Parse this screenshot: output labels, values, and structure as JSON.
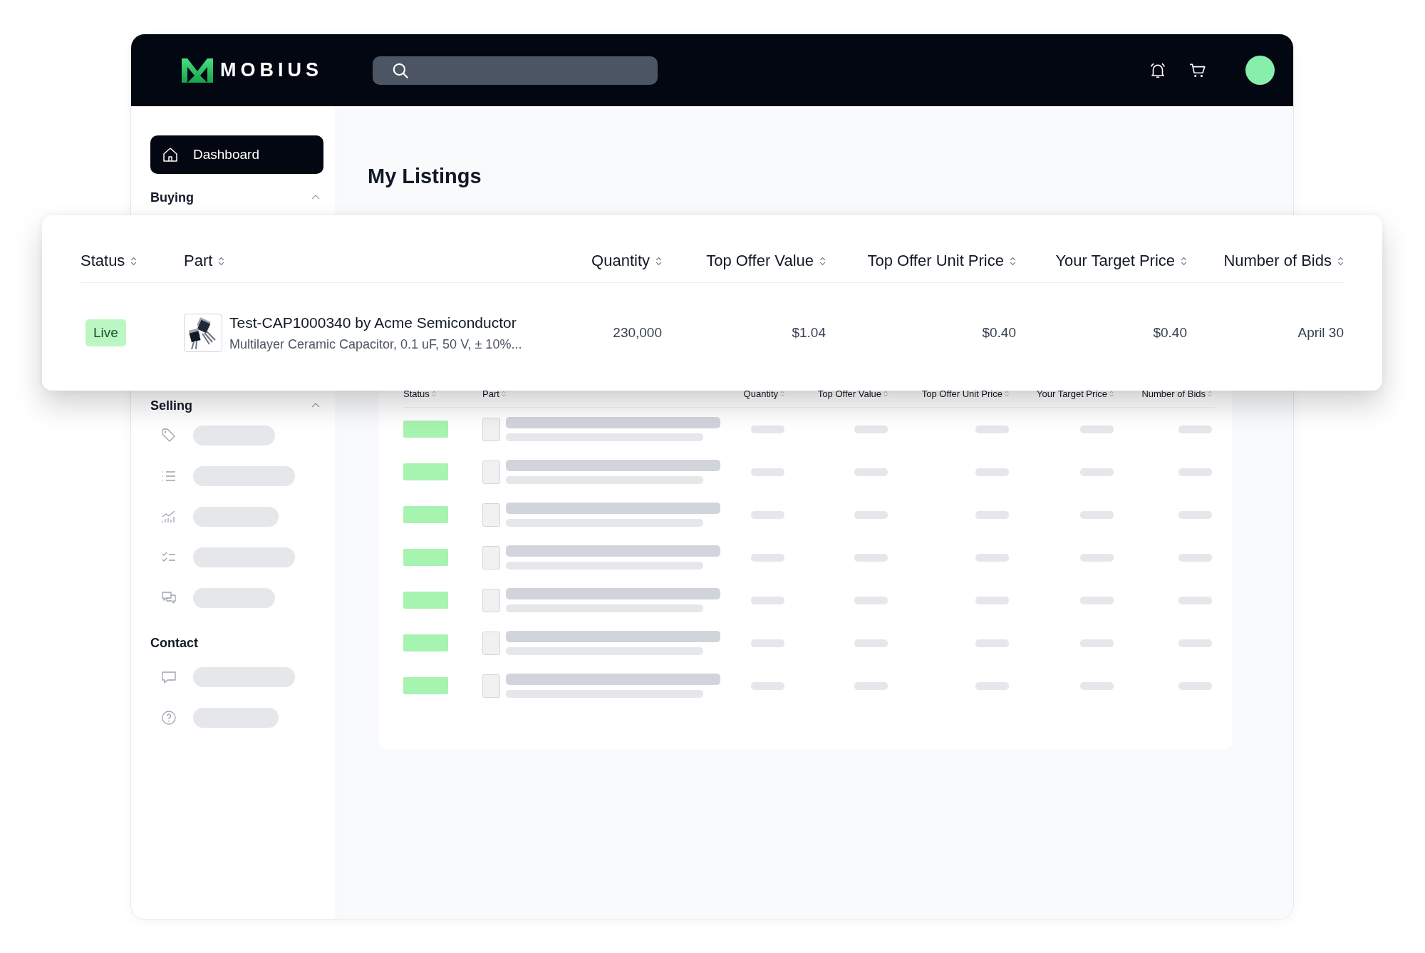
{
  "header": {
    "logo_text": "MOBIUS",
    "search": {
      "kind": "field"
    }
  },
  "sidebar": {
    "dashboard": {
      "label": "Dashboard",
      "selected": true
    },
    "sections": [
      {
        "title": "Buying",
        "expanded": true
      },
      {
        "title": "Selling",
        "expanded": true,
        "items": [
          {
            "kind": "placeholder"
          },
          {
            "kind": "placeholder"
          },
          {
            "kind": "placeholder"
          },
          {
            "kind": "placeholder"
          },
          {
            "kind": "placeholder"
          }
        ]
      },
      {
        "title": "Contact",
        "items": [
          {
            "kind": "placeholder"
          },
          {
            "kind": "placeholder"
          }
        ]
      }
    ]
  },
  "page_title": "My Listings",
  "listing_card": {
    "columns": [
      "Status",
      "Part",
      "Quantity",
      "Top Offer Value",
      "Top Offer Unit Price",
      "Your Target Price",
      "Number of Bids"
    ],
    "rows": [
      {
        "status": "Live",
        "part_name": "Test-CAP1000340 by Acme Semiconductor",
        "part_description": "Multilayer Ceramic Capacitor, 0.1 uF, 50 V, ± 10%...",
        "quantity": "230,000",
        "top_offer_value": "$1.04",
        "top_offer_unit_price": "$0.40",
        "your_target_price": "$0.40",
        "number_of_bids": "April 30"
      }
    ]
  },
  "background_table": {
    "columns": [
      "Status",
      "Part",
      "Quantity",
      "Top Offer Value",
      "Top Offer Unit Price",
      "Your Target Price",
      "Number of Bids"
    ],
    "rows": [
      {
        "kind": "placeholder"
      },
      {
        "kind": "placeholder"
      },
      {
        "kind": "placeholder"
      },
      {
        "kind": "placeholder"
      },
      {
        "kind": "placeholder"
      },
      {
        "kind": "placeholder"
      },
      {
        "kind": "placeholder"
      }
    ]
  }
}
